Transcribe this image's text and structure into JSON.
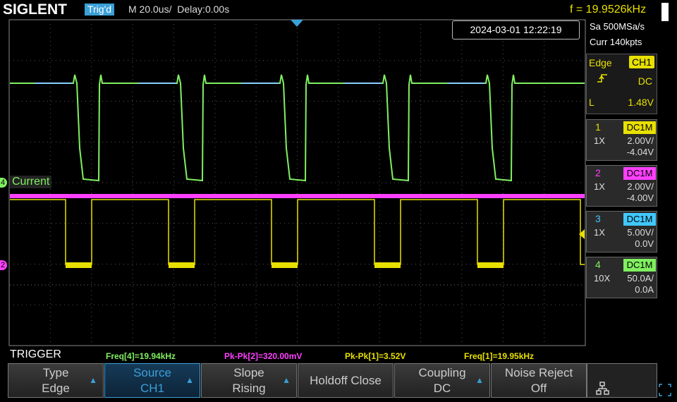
{
  "header": {
    "brand": "SIGLENT",
    "trigger_status": "Trig'd",
    "timebase": "M 20.0us/",
    "delay": "Delay:0.00s",
    "frequency": "f = 19.9526kHz",
    "datetime": "2024-03-01 12:22:19"
  },
  "acquisition": {
    "sample_rate": "Sa 500MSa/s",
    "memory": "Curr 140kpts"
  },
  "trigger_panel": {
    "type": "Edge",
    "source": "CH1",
    "coupling": "DC",
    "level_label": "L",
    "level": "1.48V"
  },
  "channels": [
    {
      "num": "1",
      "coupling": "DC1M",
      "probe": "1X",
      "scale": "2.00V/",
      "offset": "-4.04V",
      "color": "#e8e000"
    },
    {
      "num": "2",
      "coupling": "DC1M",
      "probe": "1X",
      "scale": "2.00V/",
      "offset": "-4.00V",
      "color": "#ff40ff"
    },
    {
      "num": "3",
      "coupling": "DC1M",
      "probe": "1X",
      "scale": "5.00V/",
      "offset": "0.0V",
      "color": "#40c8ff"
    },
    {
      "num": "4",
      "coupling": "DC1M",
      "probe": "10X",
      "scale": "50.0A/",
      "offset": "0.0A",
      "color": "#80f060"
    }
  ],
  "waveform_labels": {
    "ch4_marker": "4",
    "ch4_label": "Current",
    "ch2_marker": "2"
  },
  "measurements": [
    {
      "text": "Freq[4]=19.94kHz",
      "color": "#80f060"
    },
    {
      "text": "Pk-Pk[2]=320.00mV",
      "color": "#ff40ff"
    },
    {
      "text": "Pk-Pk[1]=3.52V",
      "color": "#e8e000"
    },
    {
      "text": "Freq[1]=19.95kHz",
      "color": "#e8e000"
    }
  ],
  "menu": {
    "title": "TRIGGER",
    "softkeys": [
      {
        "l1": "Type",
        "l2": "Edge"
      },
      {
        "l1": "Source",
        "l2": "CH1"
      },
      {
        "l1": "Slope",
        "l2": "Rising"
      },
      {
        "l1": "Holdoff Close",
        "l2": ""
      },
      {
        "l1": "Coupling",
        "l2": "DC"
      },
      {
        "l1": "Noise Reject",
        "l2": "Off"
      }
    ]
  }
}
